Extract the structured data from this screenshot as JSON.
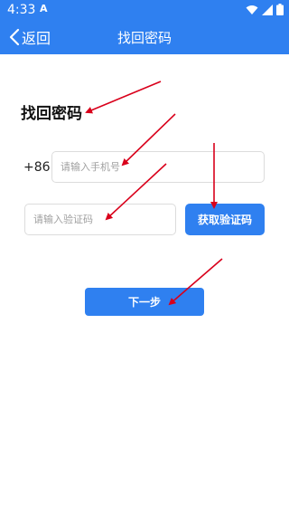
{
  "status_bar": {
    "time": "4:33",
    "notification_icon": "A",
    "icons": [
      "wifi-icon",
      "signal-icon",
      "battery-icon"
    ]
  },
  "nav": {
    "back_label": "返回",
    "title": "找回密码"
  },
  "form": {
    "heading": "找回密码",
    "country_code": "+86",
    "phone_placeholder": "请输入手机号",
    "code_placeholder": "请输入验证码",
    "get_code_label": "获取验证码",
    "next_label": "下一步"
  },
  "colors": {
    "accent": "#2f80f0",
    "annotation_arrow": "#d9001b"
  }
}
